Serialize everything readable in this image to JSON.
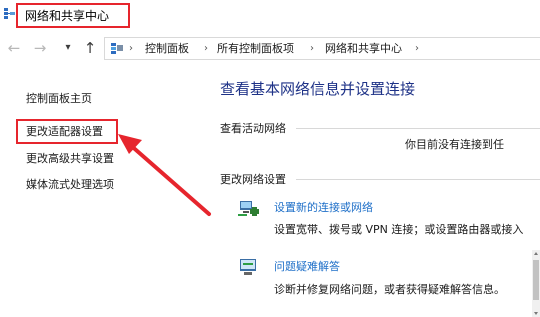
{
  "window": {
    "title": "网络和共享中心",
    "title_icon": "network-icon"
  },
  "nav": {
    "back_icon": "arrow-left-icon",
    "forward_icon": "arrow-right-icon",
    "recent_icon": "chevron-down-icon",
    "up_icon": "arrow-up-icon"
  },
  "address": {
    "icon": "control-panel-icon",
    "separator": "›",
    "crumbs": [
      "控制面板",
      "所有控制面板项",
      "网络和共享中心"
    ]
  },
  "sidebar": {
    "items": [
      {
        "label": "控制面板主页"
      },
      {
        "label": "更改适配器设置"
      },
      {
        "label": "更改高级共享设置"
      },
      {
        "label": "媒体流式处理选项"
      }
    ]
  },
  "main": {
    "heading": "查看基本网络信息并设置连接",
    "active_networks": {
      "label": "查看活动网络",
      "status": "你目前没有连接到任"
    },
    "change_settings": {
      "label": "更改网络设置",
      "tasks": [
        {
          "icon": "new-connection-icon",
          "link": "设置新的连接或网络",
          "description": "设置宽带、拨号或 VPN 连接；或设置路由器或接入"
        },
        {
          "icon": "troubleshoot-icon",
          "link": "问题疑难解答",
          "description": "诊断并修复网络问题，或者获得疑难解答信息。"
        }
      ]
    }
  },
  "colors": {
    "annotation_red": "#e6252d",
    "heading_blue": "#1e3287",
    "link_blue": "#1e6fc8"
  }
}
